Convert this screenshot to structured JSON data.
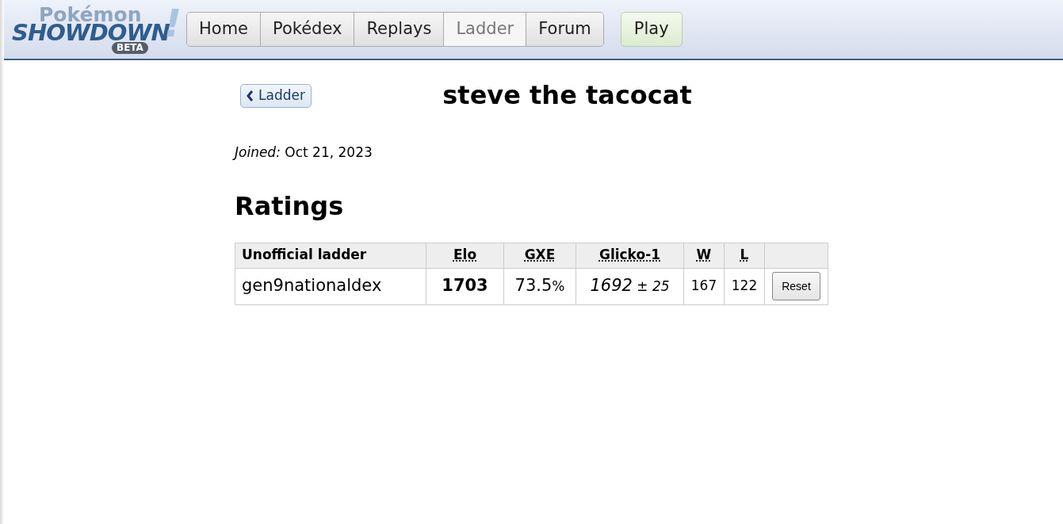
{
  "logo": {
    "top": "Pokémon",
    "main": "SHOWDOWN",
    "badge": "BETA",
    "mark": "!"
  },
  "nav": [
    {
      "label": "Home",
      "selected": false
    },
    {
      "label": "Pokédex",
      "selected": false
    },
    {
      "label": "Replays",
      "selected": false
    },
    {
      "label": "Ladder",
      "selected": true
    },
    {
      "label": "Forum",
      "selected": false
    }
  ],
  "play_button": "Play",
  "back_button": "Ladder",
  "title": "steve the tacocat",
  "joined": {
    "label": "Joined:",
    "value": "Oct 21, 2023"
  },
  "ratings_heading": "Ratings",
  "table": {
    "columns": [
      "Unofficial ladder",
      "Elo",
      "GXE",
      "Glicko-1",
      "W",
      "L"
    ],
    "rows": [
      {
        "format": "gen9nationaldex",
        "elo": "1703",
        "gxe": "73.5",
        "gxe_unit": "%",
        "glicko": "1692",
        "deviation": "± 25",
        "wins": "167",
        "losses": "122",
        "action": "Reset"
      }
    ]
  }
}
